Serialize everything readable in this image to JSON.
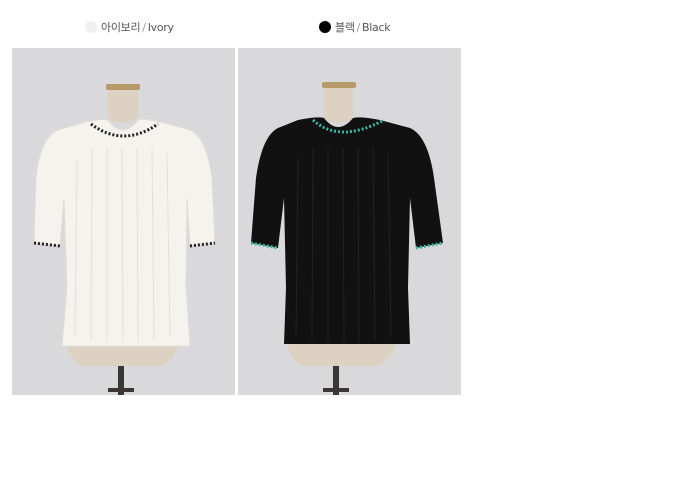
{
  "variants": [
    {
      "name_ko": "아이보리",
      "separator": "/",
      "name_en": "Ivory",
      "swatch_color": "#f0f0f0",
      "garment_color": "#f5f3ee",
      "trim_color": "#222222"
    },
    {
      "name_ko": "블랙",
      "separator": "/",
      "name_en": "Black",
      "swatch_color": "#000000",
      "garment_color": "#111111",
      "trim_color": "#3db6a0"
    }
  ],
  "colors": {
    "background": "#d8d8da",
    "mannequin": "#ddd2c2",
    "stand_metal": "#3a3633",
    "neck_cap": "#b79a6a"
  }
}
